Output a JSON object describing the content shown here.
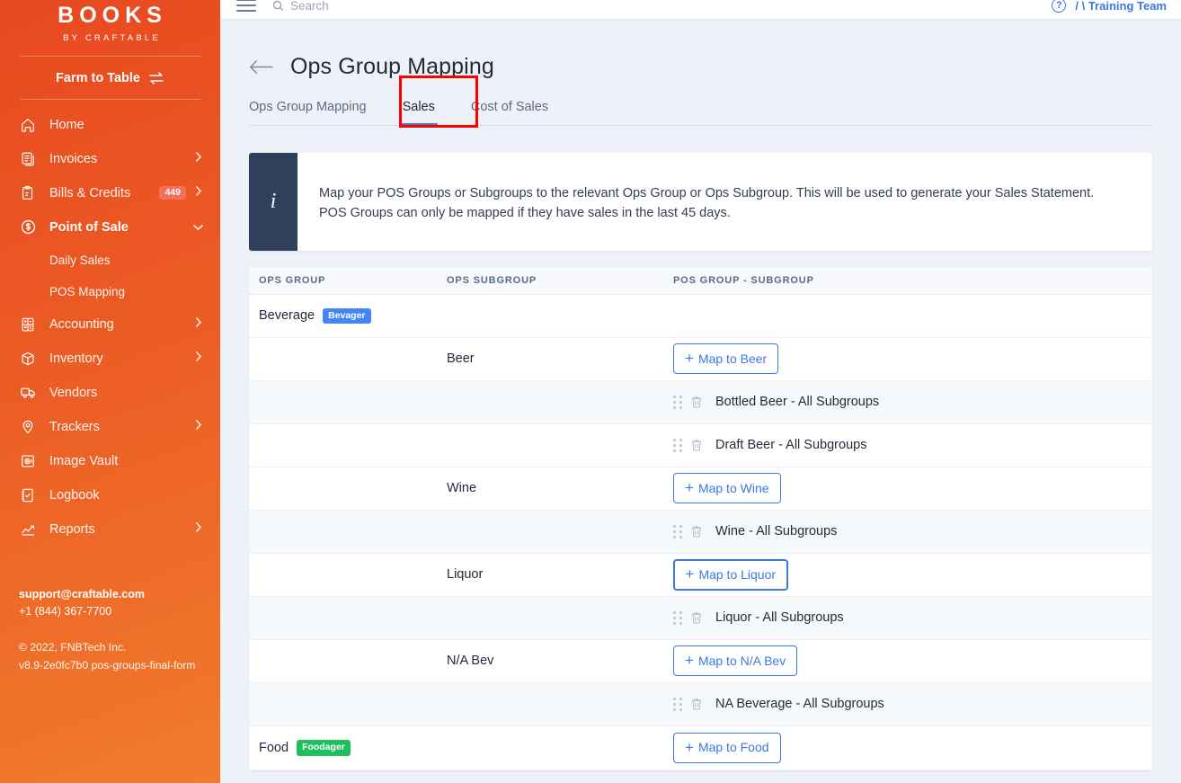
{
  "sidebar": {
    "brand_main": "BOOKS",
    "brand_sub": "BY CRAFTABLE",
    "org_name": "Farm to Table",
    "items": [
      {
        "label": "Home",
        "icon": "home-icon",
        "chevron": false,
        "badge": null,
        "active": false
      },
      {
        "label": "Invoices",
        "icon": "invoice-icon",
        "chevron": true,
        "badge": null,
        "active": false
      },
      {
        "label": "Bills & Credits",
        "icon": "clipboard-icon",
        "chevron": true,
        "badge": "449",
        "active": false
      },
      {
        "label": "Point of Sale",
        "icon": "dollar-circle-icon",
        "chevron": true,
        "badge": null,
        "active": true
      },
      {
        "label": "Accounting",
        "icon": "calculator-icon",
        "chevron": true,
        "badge": null,
        "active": false
      },
      {
        "label": "Inventory",
        "icon": "box-icon",
        "chevron": true,
        "badge": null,
        "active": false
      },
      {
        "label": "Vendors",
        "icon": "truck-icon",
        "chevron": false,
        "badge": null,
        "active": false
      },
      {
        "label": "Trackers",
        "icon": "map-pin-icon",
        "chevron": true,
        "badge": null,
        "active": false
      },
      {
        "label": "Image Vault",
        "icon": "safe-icon",
        "chevron": false,
        "badge": null,
        "active": false
      },
      {
        "label": "Logbook",
        "icon": "notebook-icon",
        "chevron": false,
        "badge": null,
        "active": false
      },
      {
        "label": "Reports",
        "icon": "chart-icon",
        "chevron": true,
        "badge": null,
        "active": false
      }
    ],
    "sub_items": [
      {
        "label": "Daily Sales"
      },
      {
        "label": "POS Mapping"
      }
    ],
    "footer": {
      "email": "support@craftable.com",
      "phone": "+1 (844) 367-7700",
      "copyright": "© 2022, FNBTech Inc.",
      "version": "v8.9-2e0fc7b0 pos-groups-final-form"
    }
  },
  "topbar": {
    "search_placeholder": "Search",
    "help_label": "?",
    "user_label": "/ \\ Training Team"
  },
  "header": {
    "title": "Ops Group Mapping",
    "back_icon": "arrow-left-icon"
  },
  "tabs": [
    {
      "label": "Ops Group Mapping",
      "active": false
    },
    {
      "label": "Sales",
      "active": true
    },
    {
      "label": "Cost of Sales",
      "active": false
    }
  ],
  "info_banner": {
    "icon": "info-icon",
    "line1": "Map your POS Groups or Subgroups to the relevant Ops Group or Ops Subgroup. This will be used to generate your Sales Statement.",
    "line2": "POS Groups can only be mapped if they have sales in the last 45 days."
  },
  "table": {
    "columns": [
      "OPS GROUP",
      "OPS SUBGROUP",
      "POS GROUP - SUBGROUP"
    ],
    "rows": [
      {
        "type": "group",
        "ops_group": "Beverage",
        "pill": "Bevager",
        "pill_color": "blue"
      },
      {
        "type": "subgroup",
        "ops_subgroup": "Beer",
        "button": "Map to Beer",
        "hover": false
      },
      {
        "type": "mapped",
        "label": "Bottled Beer - All Subgroups"
      },
      {
        "type": "mapped",
        "label": "Draft Beer - All Subgroups"
      },
      {
        "type": "subgroup",
        "ops_subgroup": "Wine",
        "button": "Map to Wine",
        "hover": false
      },
      {
        "type": "mapped",
        "label": "Wine - All Subgroups"
      },
      {
        "type": "subgroup",
        "ops_subgroup": "Liquor",
        "button": "Map to Liquor",
        "hover": true
      },
      {
        "type": "mapped",
        "label": "Liquor - All Subgroups"
      },
      {
        "type": "subgroup",
        "ops_subgroup": "N/A Bev",
        "button": "Map to N/A Bev",
        "hover": false
      },
      {
        "type": "mapped",
        "label": "NA Beverage - All Subgroups"
      },
      {
        "type": "group",
        "ops_group": "Food",
        "pill": "Foodager",
        "pill_color": "green",
        "button": "Map to Food",
        "hover": false
      }
    ]
  },
  "colors": {
    "sidebar_start": "#e8491f",
    "sidebar_end": "#f07c2c",
    "accent_blue": "#3d78e0",
    "pill_blue": "#4285f4",
    "pill_green": "#1dbf5e",
    "info_dark": "#2f405c",
    "annotation_red": "#ff0000",
    "page_bg": "#eef1f7"
  }
}
